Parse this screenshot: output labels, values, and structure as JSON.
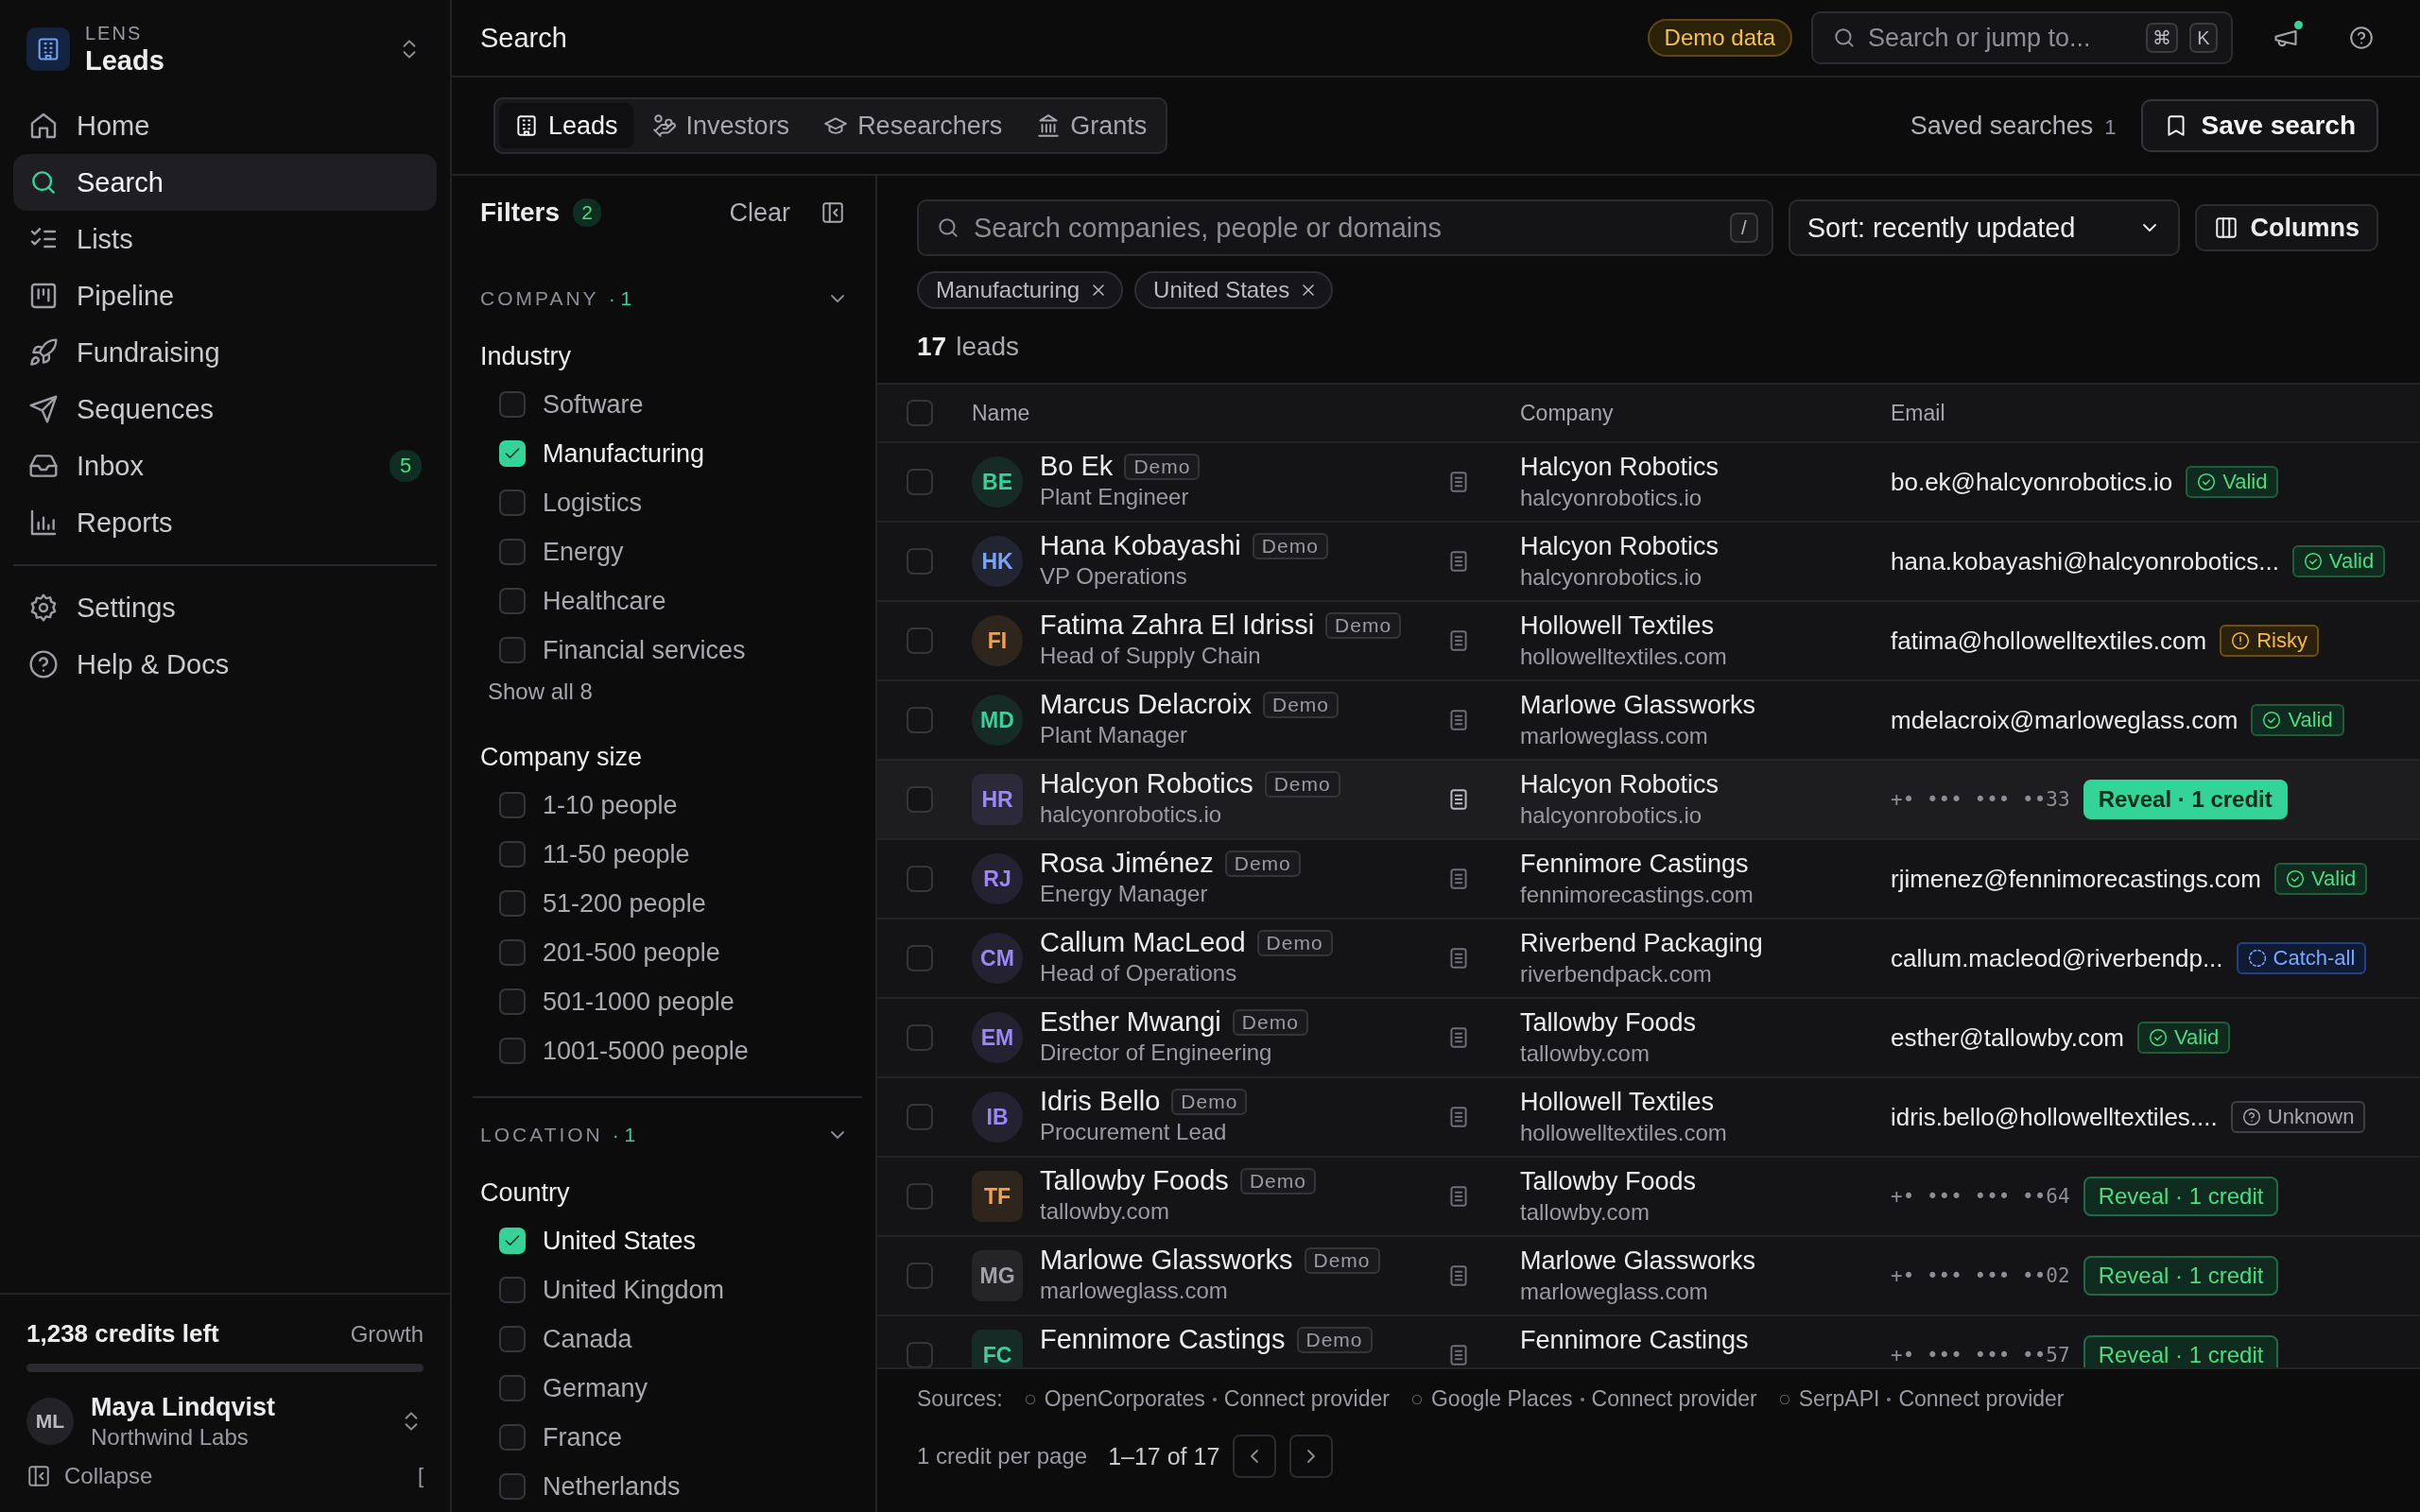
{
  "sidebar": {
    "workspace_label": "LENS",
    "workspace_name": "Leads",
    "nav": [
      {
        "label": "Home",
        "selected": false
      },
      {
        "label": "Search",
        "selected": true
      },
      {
        "label": "Lists",
        "selected": false
      },
      {
        "label": "Pipeline",
        "selected": false
      },
      {
        "label": "Fundraising",
        "selected": false
      },
      {
        "label": "Sequences",
        "selected": false
      },
      {
        "label": "Inbox",
        "selected": false,
        "badge": "5"
      },
      {
        "label": "Reports",
        "selected": false
      }
    ],
    "secondary": [
      {
        "label": "Settings",
        "selected": false
      },
      {
        "label": "Help & Docs",
        "selected": false
      }
    ],
    "credits": {
      "text": "1,238 credits left",
      "plan": "Growth"
    },
    "user": {
      "initials": "ML",
      "name": "Maya Lindqvist",
      "org": "Northwind Labs"
    },
    "collapse": {
      "label": "Collapse",
      "shortcut": "["
    }
  },
  "topbar": {
    "title": "Search",
    "demo_badge": "Demo data",
    "search_placeholder": "Search or jump to...",
    "shortcut_keys": [
      "⌘",
      "K"
    ],
    "notification_dot": true
  },
  "entity_tabs": [
    {
      "label": "Leads",
      "selected": true
    },
    {
      "label": "Investors",
      "selected": false
    },
    {
      "label": "Researchers",
      "selected": false
    },
    {
      "label": "Grants",
      "selected": false
    }
  ],
  "saved_searches": {
    "label": "Saved searches",
    "count": "1"
  },
  "save_button": "Save search",
  "filters": {
    "title": "Filters",
    "count": "2",
    "clear": "Clear",
    "sections": [
      {
        "title": "COMPANY",
        "count": "· 1",
        "expanded": true,
        "groups": [
          {
            "title": "Industry",
            "options": [
              {
                "label": "Software",
                "checked": false
              },
              {
                "label": "Manufacturing",
                "checked": true
              },
              {
                "label": "Logistics",
                "checked": false
              },
              {
                "label": "Energy",
                "checked": false
              },
              {
                "label": "Healthcare",
                "checked": false
              },
              {
                "label": "Financial services",
                "checked": false
              }
            ],
            "show_all": "Show all 8"
          },
          {
            "title": "Company size",
            "options": [
              {
                "label": "1-10 people",
                "checked": false
              },
              {
                "label": "11-50 people",
                "checked": false
              },
              {
                "label": "51-200 people",
                "checked": false
              },
              {
                "label": "201-500 people",
                "checked": false
              },
              {
                "label": "501-1000 people",
                "checked": false
              },
              {
                "label": "1001-5000 people",
                "checked": false
              }
            ]
          }
        ]
      },
      {
        "title": "LOCATION",
        "count": "· 1",
        "expanded": true,
        "groups": [
          {
            "title": "Country",
            "options": [
              {
                "label": "United States",
                "checked": true
              },
              {
                "label": "United Kingdom",
                "checked": false
              },
              {
                "label": "Canada",
                "checked": false
              },
              {
                "label": "Germany",
                "checked": false
              },
              {
                "label": "France",
                "checked": false
              },
              {
                "label": "Netherlands",
                "checked": false
              }
            ]
          }
        ]
      }
    ]
  },
  "search": {
    "placeholder": "Search companies, people or domains",
    "shortcut": "/"
  },
  "sort": {
    "value": "Sort: recently updated"
  },
  "columns_button": "Columns",
  "active_filters": [
    "Manufacturing",
    "United States"
  ],
  "results": {
    "count": "17",
    "label": "leads"
  },
  "table": {
    "columns": [
      "Name",
      "Company",
      "Email"
    ],
    "all_selected": false,
    "rows": [
      {
        "kind": "person",
        "initials": "BE",
        "color": "#34d399",
        "name": "Bo Ek",
        "tag": "Demo",
        "subtitle": "Plant Engineer",
        "company": "Halcyon Robotics",
        "domain": "halcyonrobotics.io",
        "highlighted": false,
        "selected": false,
        "contact": {
          "kind": "email",
          "email": "bo.ek@halcyonrobotics.io",
          "status": {
            "kind": "valid",
            "label": "Valid"
          }
        }
      },
      {
        "kind": "person",
        "initials": "HK",
        "color": "#7aa2f7",
        "name": "Hana Kobayashi",
        "tag": "Demo",
        "subtitle": "VP Operations",
        "company": "Halcyon Robotics",
        "domain": "halcyonrobotics.io",
        "highlighted": false,
        "selected": false,
        "contact": {
          "kind": "email",
          "email": "hana.kobayashi@halcyonrobotics...",
          "status": {
            "kind": "valid",
            "label": "Valid"
          }
        }
      },
      {
        "kind": "person",
        "initials": "FI",
        "color": "#f0a24a",
        "name": "Fatima Zahra El Idrissi",
        "tag": "Demo",
        "subtitle": "Head of Supply Chain",
        "company": "Hollowell Textiles",
        "domain": "hollowelltextiles.com",
        "highlighted": false,
        "selected": false,
        "contact": {
          "kind": "email",
          "email": "fatima@hollowelltextiles.com",
          "status": {
            "kind": "risky",
            "label": "Risky"
          }
        }
      },
      {
        "kind": "person",
        "initials": "MD",
        "color": "#34d399",
        "name": "Marcus Delacroix",
        "tag": "Demo",
        "subtitle": "Plant Manager",
        "company": "Marlowe Glassworks",
        "domain": "marloweglass.com",
        "highlighted": false,
        "selected": false,
        "contact": {
          "kind": "email",
          "email": "mdelacroix@marloweglass.com",
          "status": {
            "kind": "valid",
            "label": "Valid"
          }
        }
      },
      {
        "kind": "company",
        "initials": "HR",
        "color": "#9b87f5",
        "name": "Halcyon Robotics",
        "tag": "Demo",
        "subtitle": "halcyonrobotics.io",
        "company": "Halcyon Robotics",
        "domain": "halcyonrobotics.io",
        "highlighted": true,
        "selected": false,
        "contact": {
          "kind": "masked",
          "masked": "+• ••• ••• ••33",
          "reveal": "Reveal · 1 credit"
        }
      },
      {
        "kind": "person",
        "initials": "RJ",
        "color": "#9b87f5",
        "name": "Rosa Jiménez",
        "tag": "Demo",
        "subtitle": "Energy Manager",
        "company": "Fennimore Castings",
        "domain": "fennimorecastings.com",
        "highlighted": false,
        "selected": false,
        "contact": {
          "kind": "email",
          "email": "rjimenez@fennimorecastings.com",
          "status": {
            "kind": "valid",
            "label": "Valid"
          }
        }
      },
      {
        "kind": "person",
        "initials": "CM",
        "color": "#9b87f5",
        "name": "Callum MacLeod",
        "tag": "Demo",
        "subtitle": "Head of Operations",
        "company": "Riverbend Packaging",
        "domain": "riverbendpack.com",
        "highlighted": false,
        "selected": false,
        "contact": {
          "kind": "email",
          "email": "callum.macleod@riverbendp...",
          "status": {
            "kind": "catchall",
            "label": "Catch-all"
          }
        }
      },
      {
        "kind": "person",
        "initials": "EM",
        "color": "#9b87f5",
        "name": "Esther Mwangi",
        "tag": "Demo",
        "subtitle": "Director of Engineering",
        "company": "Tallowby Foods",
        "domain": "tallowby.com",
        "highlighted": false,
        "selected": false,
        "contact": {
          "kind": "email",
          "email": "esther@tallowby.com",
          "status": {
            "kind": "valid",
            "label": "Valid"
          }
        }
      },
      {
        "kind": "person",
        "initials": "IB",
        "color": "#9b87f5",
        "name": "Idris Bello",
        "tag": "Demo",
        "subtitle": "Procurement Lead",
        "company": "Hollowell Textiles",
        "domain": "hollowelltextiles.com",
        "highlighted": false,
        "selected": false,
        "contact": {
          "kind": "email",
          "email": "idris.bello@hollowelltextiles....",
          "status": {
            "kind": "unknown",
            "label": "Unknown"
          }
        }
      },
      {
        "kind": "company",
        "initials": "TF",
        "color": "#f0a24a",
        "name": "Tallowby Foods",
        "tag": "Demo",
        "subtitle": "tallowby.com",
        "company": "Tallowby Foods",
        "domain": "tallowby.com",
        "highlighted": false,
        "selected": false,
        "contact": {
          "kind": "masked",
          "masked": "+• ••• ••• ••64",
          "reveal": "Reveal · 1 credit"
        }
      },
      {
        "kind": "company",
        "initials": "MG",
        "color": "#a1a1aa",
        "name": "Marlowe Glassworks",
        "tag": "Demo",
        "subtitle": "marloweglass.com",
        "company": "Marlowe Glassworks",
        "domain": "marloweglass.com",
        "highlighted": false,
        "selected": false,
        "contact": {
          "kind": "masked",
          "masked": "+• ••• ••• ••02",
          "reveal": "Reveal · 1 credit"
        }
      },
      {
        "kind": "company",
        "initials": "FC",
        "color": "#34d399",
        "name": "Fennimore Castings",
        "tag": "Demo",
        "company": "Fennimore Castings",
        "highlighted": false,
        "selected": false,
        "contact": {
          "kind": "masked",
          "masked": "+• ••• ••• ••57",
          "reveal": "Reveal · 1 credit"
        }
      }
    ]
  },
  "footer": {
    "sources_label": "Sources:",
    "sources": [
      {
        "name": "OpenCorporates",
        "action": "Connect provider"
      },
      {
        "name": "Google Places",
        "action": "Connect provider"
      },
      {
        "name": "SerpAPI",
        "action": "Connect provider"
      }
    ],
    "per_page": "1 credit per page",
    "range": "1–17 of 17"
  }
}
